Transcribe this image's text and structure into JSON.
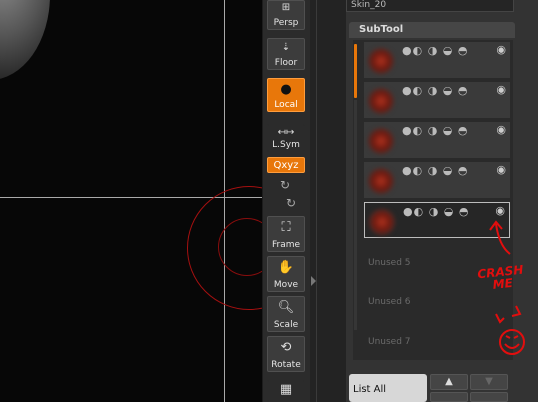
{
  "skin_field": "Skin_20",
  "shelf": {
    "persp": "Persp",
    "floor": "Floor",
    "local": "Local",
    "lsym": "L.Sym",
    "xyz": "Qxyz",
    "frame": "Frame",
    "move": "Move",
    "scale": "Scale",
    "rotate": "Rotate"
  },
  "subtool": {
    "title": "SubTool",
    "unused": [
      "Unused  5",
      "Unused  6",
      "Unused  7"
    ],
    "list_all": "List  All"
  },
  "annotation": {
    "line1": "CRASH",
    "line2": "ME"
  },
  "colors": {
    "accent": "#e8770a",
    "brush": "#a51010",
    "annotation": "#e20e0e"
  }
}
